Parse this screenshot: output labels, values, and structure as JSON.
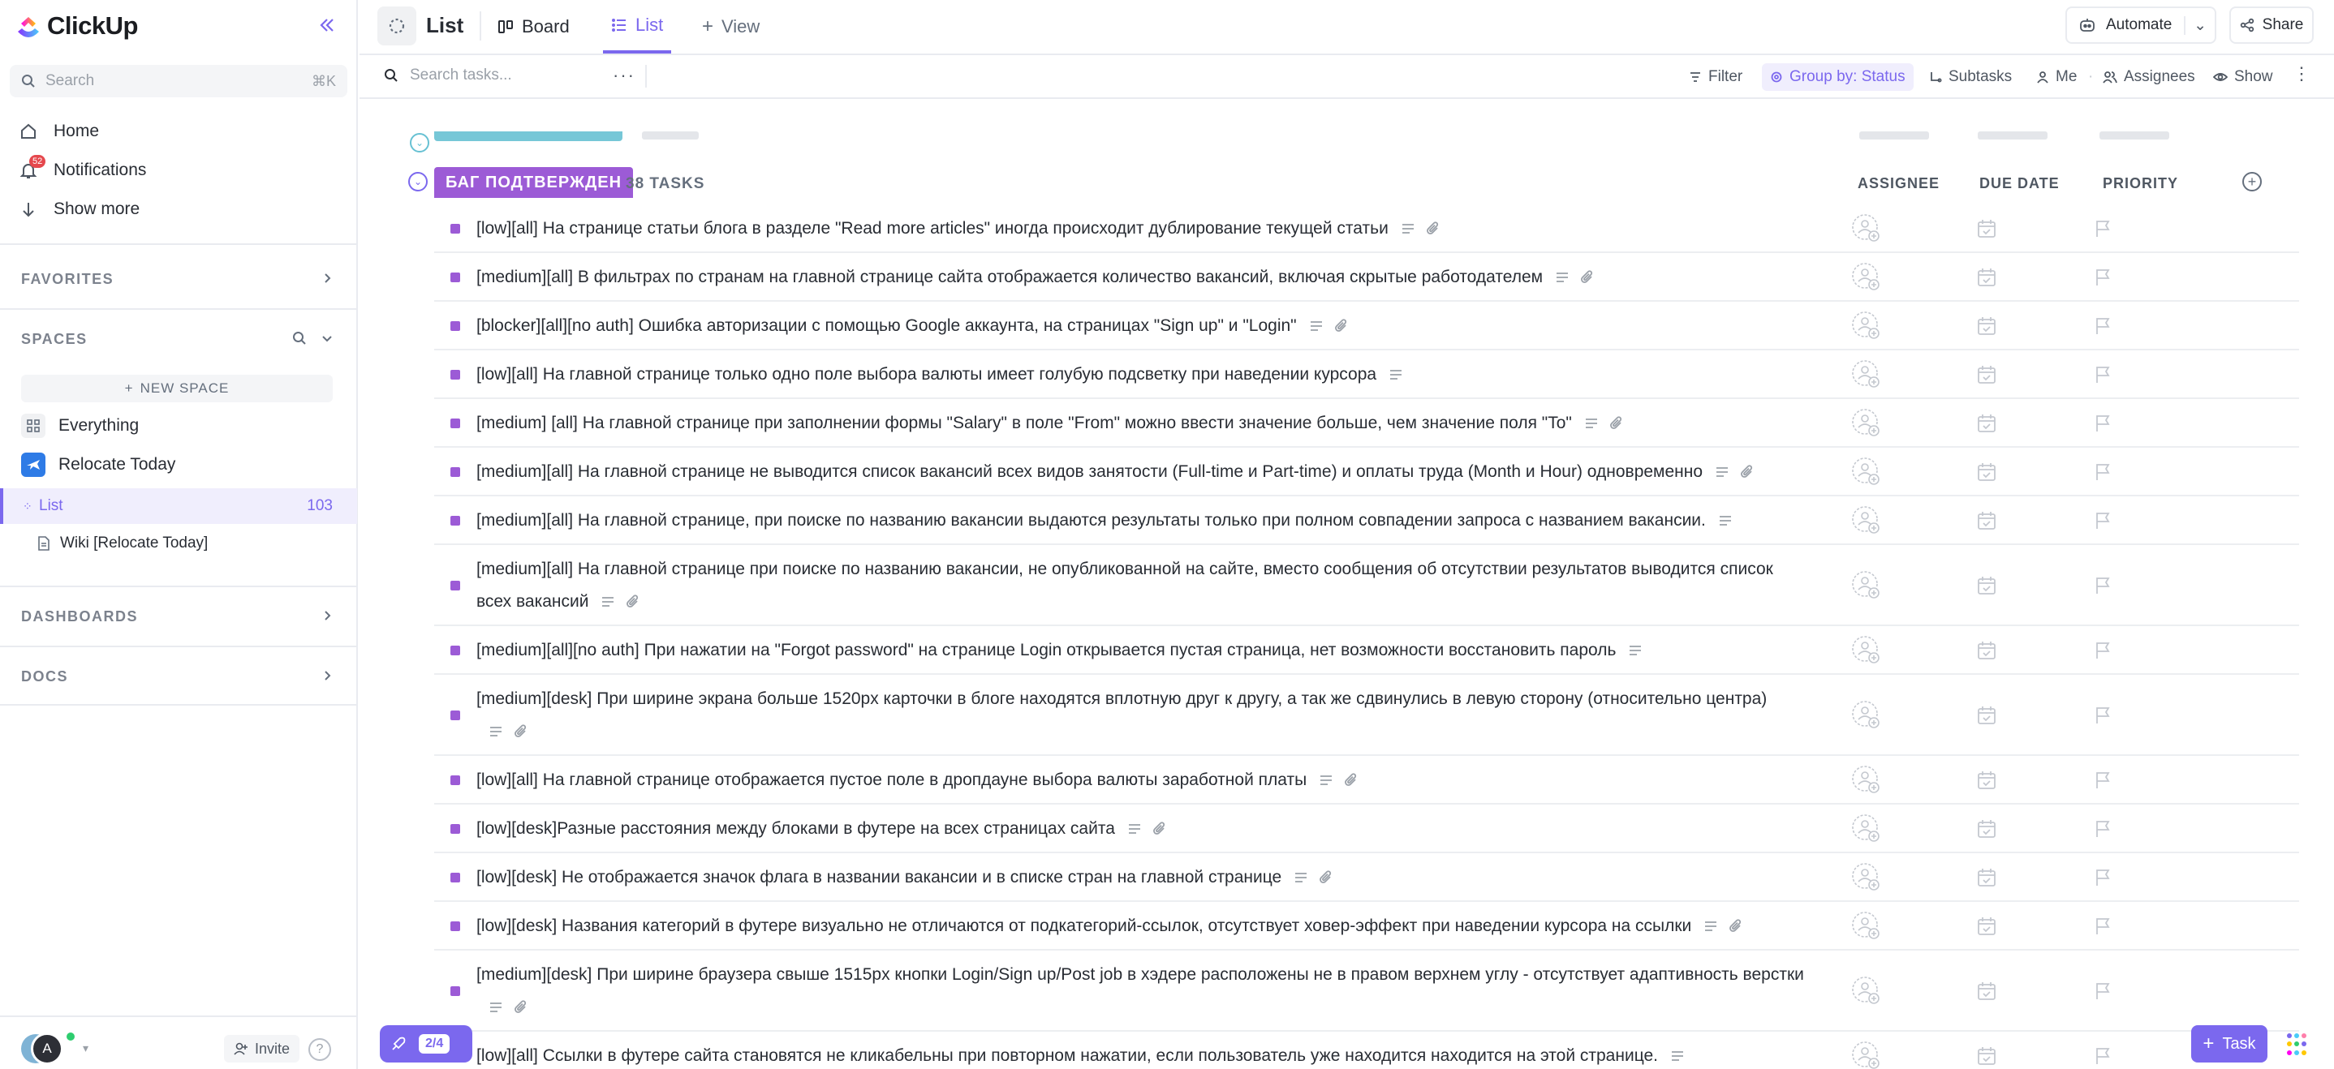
{
  "app": {
    "name": "ClickUp"
  },
  "sidebar": {
    "search_placeholder": "Search",
    "search_shortcut": "⌘K",
    "nav": [
      {
        "label": "Home",
        "icon": "home-icon"
      },
      {
        "label": "Notifications",
        "icon": "bell-icon",
        "badge": "52"
      },
      {
        "label": "Show more",
        "icon": "arrow-down-icon"
      }
    ],
    "favorites_label": "FAVORITES",
    "spaces_label": "SPACES",
    "new_space_label": "NEW SPACE",
    "everything_label": "Everything",
    "space_name": "Relocate Today",
    "list_name": "List",
    "list_count": "103",
    "wiki_name": "Wiki [Relocate Today]",
    "dashboards_label": "DASHBOARDS",
    "docs_label": "DOCS",
    "avatar_initial": "A",
    "invite_label": "Invite",
    "help_label": "?"
  },
  "topbar": {
    "title": "List",
    "tabs": [
      {
        "label": "Board",
        "icon": "board-icon"
      },
      {
        "label": "List",
        "icon": "list-icon",
        "active": true
      },
      {
        "label": "View",
        "icon": "plus-icon"
      }
    ],
    "automate_label": "Automate",
    "share_label": "Share"
  },
  "toolbar": {
    "search_placeholder": "Search tasks...",
    "filter_label": "Filter",
    "groupby_label": "Group by: Status",
    "subtasks_label": "Subtasks",
    "me_label": "Me",
    "assignees_label": "Assignees",
    "show_label": "Show"
  },
  "group": {
    "status": "БАГ ПОДТВЕРЖДЕН",
    "status_color": "#9c5bd6",
    "task_count": "38 TASKS",
    "columns": {
      "assignee": "ASSIGNEE",
      "due_date": "DUE DATE",
      "priority": "PRIORITY"
    }
  },
  "tasks": [
    {
      "name": "[low][all] На странице статьи блога в разделе \"Read more articles\" иногда происходит дублирование текущей статьи",
      "attach": true
    },
    {
      "name": "[medium][all] В фильтрах по странам на главной странице сайта отображается количество вакансий, включая скрытые работодателем",
      "attach": true
    },
    {
      "name": "[blocker][all][no auth] Ошибка авторизации с помощью Google аккаунта, на страницах \"Sign up\" и \"Login\"",
      "attach": true
    },
    {
      "name": "[low][all] На главной странице только одно поле выбора валюты имеет голубую подсветку при наведении курсора",
      "attach": false
    },
    {
      "name": "[medium] [all] На главной странице при заполнении формы \"Salary\" в поле \"From\" можно ввести значение больше, чем значение поля \"To\"",
      "attach": true
    },
    {
      "name": "[medium][all] На главной странице не выводится список вакансий всех видов занятости (Full-time и Part-time) и оплаты труда (Month и Hour) одновременно",
      "attach": true
    },
    {
      "name": "[medium][all] На главной странице, при поиске по названию вакансии выдаются результаты только при полном совпадении запроса с названием вакансии.",
      "attach": false
    },
    {
      "name": "[medium][all] На главной странице при поиске по названию вакансии, не опубликованной на сайте, вместо сообщения об отсутствии результатов выводится список всех вакансий",
      "attach": true
    },
    {
      "name": "[medium][all][no auth] При нажатии на \"Forgot password\" на странице Login открывается пустая страница, нет возможности восстановить пароль",
      "attach": false
    },
    {
      "name": "[medium][desk] При ширине экрана больше 1520px карточки в блоге находятся вплотную друг к другу, а так же сдвинулись в левую сторону (относительно центра)",
      "attach": true
    },
    {
      "name": "[low][all] На главной странице отображается пустое поле в дропдауне выбора валюты заработной платы",
      "attach": true
    },
    {
      "name": "[low][desk]Разные расстояния между блоками в футере на всех страницах сайта",
      "attach": true
    },
    {
      "name": "[low][desk] Не отображается значок флага в названии вакансии и в списке стран на главной странице",
      "attach": true
    },
    {
      "name": "[low][desk] Названия категорий в футере визуально не отличаются от подкатегорий-ссылок, отсутствует ховер-эффект при наведении курсора на ссылки",
      "attach": true
    },
    {
      "name": "[medium][desk] При ширине браузера свыше 1515px кнопки Login/Sign up/Post job в хэдере расположены не в правом верхнем углу - отсутствует адаптивность верстки",
      "attach": true
    },
    {
      "name": "[low][all] Ссылки в футере сайта становятся не кликабельны при повторном нажатии, если пользователь уже находится находится на этой странице.",
      "attach": false
    }
  ],
  "floating": {
    "pager": "2/4",
    "task_button": "Task"
  },
  "colors": {
    "accent": "#7b68ee",
    "status": "#9c5bd6",
    "previous_status": "#67c1d3"
  }
}
